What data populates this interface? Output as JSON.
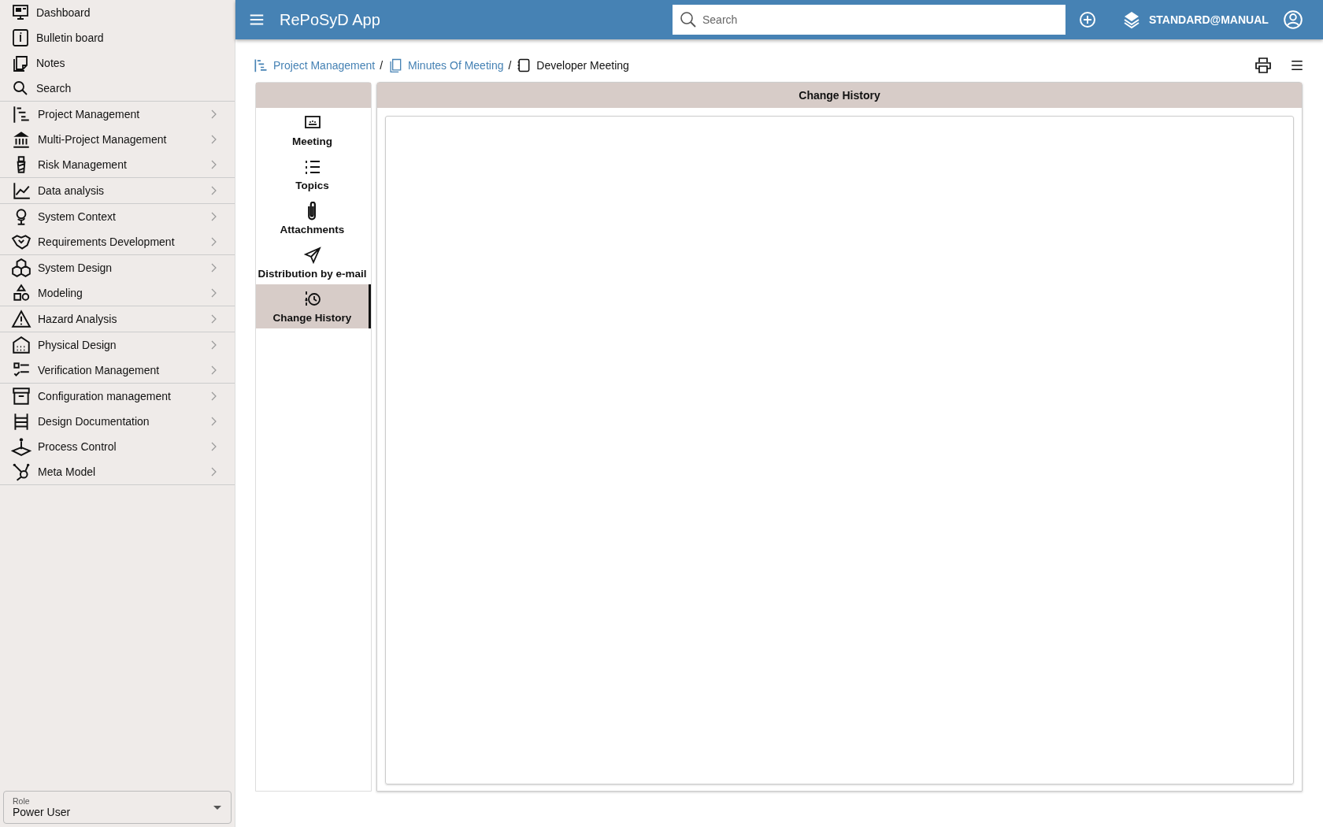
{
  "header": {
    "title": "RePoSyD App",
    "search": {
      "placeholder": "Search"
    },
    "user": "STANDARD@MANUAL"
  },
  "sidebar": {
    "groups": [
      [
        {
          "label": "Dashboard",
          "kind": "link"
        },
        {
          "label": "Bulletin board",
          "kind": "link"
        },
        {
          "label": "Notes",
          "kind": "link"
        },
        {
          "label": "Search",
          "kind": "link"
        }
      ],
      [
        {
          "label": "Project Management",
          "kind": "menu"
        },
        {
          "label": "Multi-Project Management",
          "kind": "menu"
        },
        {
          "label": "Risk Management",
          "kind": "menu"
        }
      ],
      [
        {
          "label": "Data analysis",
          "kind": "menu"
        }
      ],
      [
        {
          "label": "System Context",
          "kind": "menu"
        },
        {
          "label": "Requirements Development",
          "kind": "menu"
        }
      ],
      [
        {
          "label": "System Design",
          "kind": "menu"
        },
        {
          "label": "Modeling",
          "kind": "menu"
        }
      ],
      [
        {
          "label": "Hazard Analysis",
          "kind": "menu"
        }
      ],
      [
        {
          "label": "Physical Design",
          "kind": "menu"
        },
        {
          "label": "Verification Management",
          "kind": "menu"
        }
      ],
      [
        {
          "label": "Configuration management",
          "kind": "menu"
        },
        {
          "label": "Design Documentation",
          "kind": "menu"
        },
        {
          "label": "Process Control",
          "kind": "menu"
        },
        {
          "label": "Meta Model",
          "kind": "menu"
        }
      ]
    ],
    "role": {
      "label": "Role",
      "value": "Power User"
    }
  },
  "breadcrumb_separator": "/",
  "breadcrumb": [
    {
      "label": "Project Management",
      "kind": "link"
    },
    {
      "label": "Minutes Of Meeting",
      "kind": "link"
    },
    {
      "label": "Developer Meeting",
      "kind": "current"
    }
  ],
  "tabs": [
    {
      "label": "Meeting",
      "selected": false
    },
    {
      "label": "Topics",
      "selected": false
    },
    {
      "label": "Attachments",
      "selected": false
    },
    {
      "label": "Distribution by e-mail",
      "selected": false
    },
    {
      "label": "Change History",
      "selected": true
    }
  ],
  "panel": {
    "title": "Change History"
  }
}
